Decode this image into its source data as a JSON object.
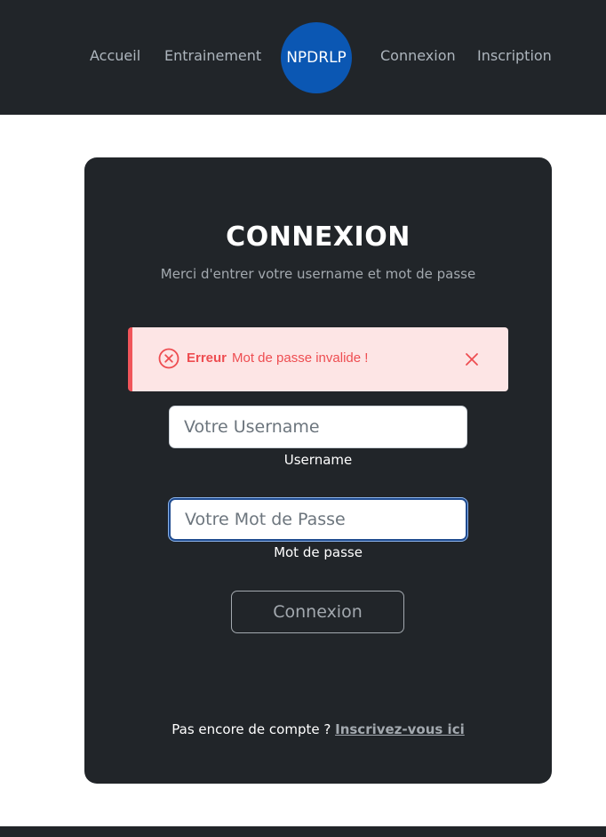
{
  "nav": {
    "links": [
      "Accueil",
      "Entrainement",
      "Connexion",
      "Inscription"
    ],
    "logo_text": "NPDRLP",
    "logo_color": "#0b57b3"
  },
  "card": {
    "title": "CONNEXION",
    "subtitle": "Merci d'entrer votre username et mot de passe"
  },
  "alert": {
    "title": "Erreur",
    "message": "Mot de passe invalide !",
    "icon": "x-circle-icon",
    "close_icon": "close-icon",
    "color": "#ee4d51"
  },
  "form": {
    "username": {
      "value": "",
      "placeholder": "Votre Username",
      "label": "Username"
    },
    "password": {
      "value": "",
      "placeholder": "Votre Mot de Passe",
      "label": "Mot de passe"
    },
    "submit_label": "Connexion"
  },
  "signup": {
    "prompt": "Pas encore de compte ?",
    "link_text": "Inscrivez-vous ici"
  },
  "colors": {
    "dark": "#212529",
    "muted": "#a3a9af"
  }
}
